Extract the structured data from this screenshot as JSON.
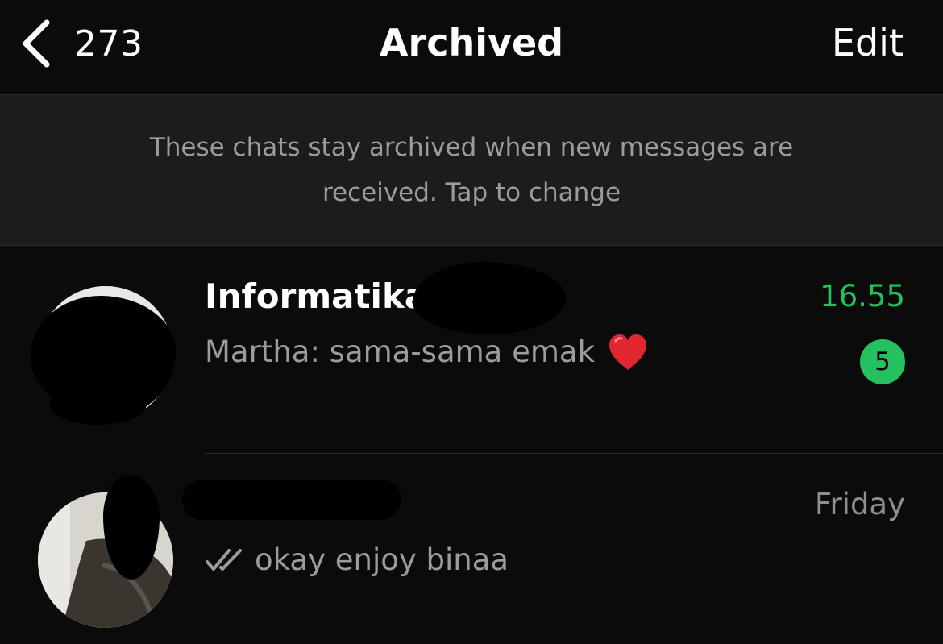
{
  "navbar": {
    "back_count": "273",
    "title": "Archived",
    "edit_label": "Edit"
  },
  "info_banner": {
    "text": "These chats stay archived when new messages are received. Tap to change"
  },
  "chats": [
    {
      "name": "Informatika",
      "time": "16.55",
      "preview": "Martha: sama-sama emak",
      "preview_emoji": "heart-icon",
      "unread_count": "5"
    },
    {
      "name": "",
      "time": "Friday",
      "preview": "okay enjoy binaa",
      "status_icon": "double-check-icon"
    }
  ],
  "colors": {
    "background": "#0b0b0b",
    "banner_background": "#1c1c1e",
    "accent_green": "#25c15f",
    "secondary_text": "#9b9ba0",
    "heart_red": "#e0262f"
  }
}
